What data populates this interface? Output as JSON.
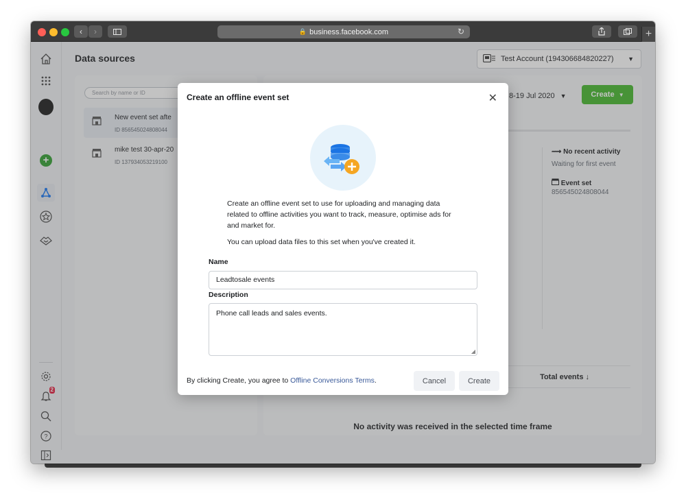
{
  "browser": {
    "url": "business.facebook.com",
    "back_icon": "chevron-left",
    "forward_icon": "chevron-right"
  },
  "sidebar": {
    "notification_count": "2"
  },
  "header": {
    "title": "Data sources",
    "account": "Test Account (194306684820227)"
  },
  "list": {
    "search_placeholder": "Search by name or ID",
    "items": [
      {
        "name": "New event set afte",
        "id": "ID 856545024808044"
      },
      {
        "name": "mike test 30-apr-20",
        "id": "ID 137934053219100"
      }
    ]
  },
  "detail": {
    "date_range": "8-19 Jul 2020",
    "create_label": "Create",
    "activity_title": "No recent activity",
    "activity_sub": "Waiting for first event",
    "event_set_title": "Event set",
    "event_set_id": "856545024808044",
    "total_events": "Total events",
    "no_activity": "No activity was received in the selected time frame"
  },
  "modal": {
    "title": "Create an offline event set",
    "paragraph1": "Create an offline event set to use for uploading and managing data related to offline activities you want to track, measure, optimise ads for and market for.",
    "paragraph2": "You can upload data files to this set when you've created it.",
    "name_label": "Name",
    "name_value": "Leadtosale events",
    "description_label": "Description",
    "description_value": "Phone call leads and sales events.",
    "terms_prefix": "By clicking Create, you agree to ",
    "terms_link": "Offline Conversions Terms",
    "terms_suffix": ".",
    "cancel_label": "Cancel",
    "create_label": "Create"
  },
  "colors": {
    "accent_green": "#42b72a",
    "link_blue": "#385898",
    "modal_icon_bg": "#e7f3fb"
  }
}
